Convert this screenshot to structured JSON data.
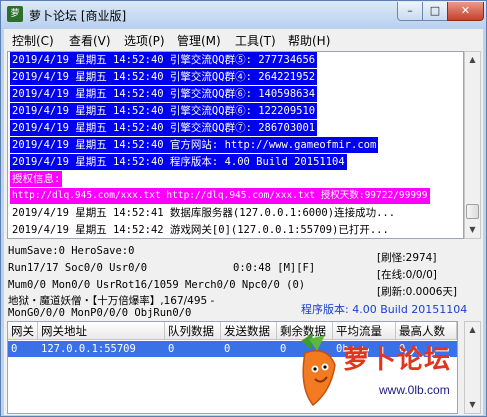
{
  "window": {
    "title": "萝卜论坛 [商业版]",
    "min_label": "–",
    "max_label": "□",
    "close_label": "✕",
    "icon_label": "萝"
  },
  "menu": [
    "控制(C)",
    "查看(V)",
    "选项(P)",
    "管理(M)",
    "工具(T)",
    "帮助(H)"
  ],
  "log": {
    "lines": [
      {
        "text": "2019/4/19 星期五 14:52:40 引擎交流QQ群⑤: 277734656",
        "style": "blue"
      },
      {
        "text": "2019/4/19 星期五 14:52:40 引擎交流QQ群④: 264221952",
        "style": "blue"
      },
      {
        "text": "2019/4/19 星期五 14:52:40 引擎交流QQ群⑥: 140598634",
        "style": "blue"
      },
      {
        "text": "2019/4/19 星期五 14:52:40 引擎交流QQ群⑥: 122209510",
        "style": "blue"
      },
      {
        "text": "2019/4/19 星期五 14:52:40 引擎交流QQ群⑦: 286703001",
        "style": "blue"
      },
      {
        "text": "2019/4/19 星期五 14:52:40 官方网站: http://www.gameofmir.com",
        "style": "blue"
      },
      {
        "text": "2019/4/19 星期五 14:52:40 程序版本: 4.00 Build 20151104",
        "style": "blue"
      },
      {
        "text": "授权信息:",
        "style": "magenta"
      },
      {
        "text": "http://dlq.945.com/xxx.txt http://dlq.945.com/xxx.txt 授权天数:99722/99999",
        "style": "magenta"
      },
      {
        "text": "2019/4/19 星期五 14:52:41 数据库服务器(127.0.0.1:6000)连接成功...",
        "style": "plain"
      },
      {
        "text": "2019/4/19 星期五 14:52:42 游戏网关[0](127.0.0.1:55709)已打开...",
        "style": "plain"
      }
    ]
  },
  "stats": {
    "line1": "HumSave:0 HeroSave:0",
    "line2": "Run17/17 Soc0/0 Usr0/0",
    "timer": "0:0:48 [M][F]",
    "line3": "Mum0/0 Mon0/0 UsrRot16/1059 Merch0/0 Npc0/0 (0)",
    "line4": "地狱・魔道妖僧・【十万倍爆率】,167/495 -",
    "line5": "MonG0/0/0 MonP0/0/0 ObjRun0/0",
    "refresh": "[刷怪:2974]",
    "online": "[在线:0/0/0]",
    "refresh_rate": "[刷新:0.0006天]",
    "version": "程序版本: 4.00 Build 20151104"
  },
  "gateway_table": {
    "columns": [
      "网关",
      "网关地址",
      "队列数据",
      "发送数据",
      "剩余数据",
      "平均流量",
      "最高人数"
    ],
    "rows": [
      [
        "0",
        "127.0.0.1:55709",
        "0",
        "0",
        "0",
        "0b",
        "0"
      ]
    ]
  },
  "logo": {
    "text": "萝卜论坛",
    "url": "www.0lb.com"
  },
  "colors": {
    "log_blue_bg": "#0000f0",
    "log_magenta_bg": "#ff00ff",
    "selection_row": "#3a71e6"
  }
}
